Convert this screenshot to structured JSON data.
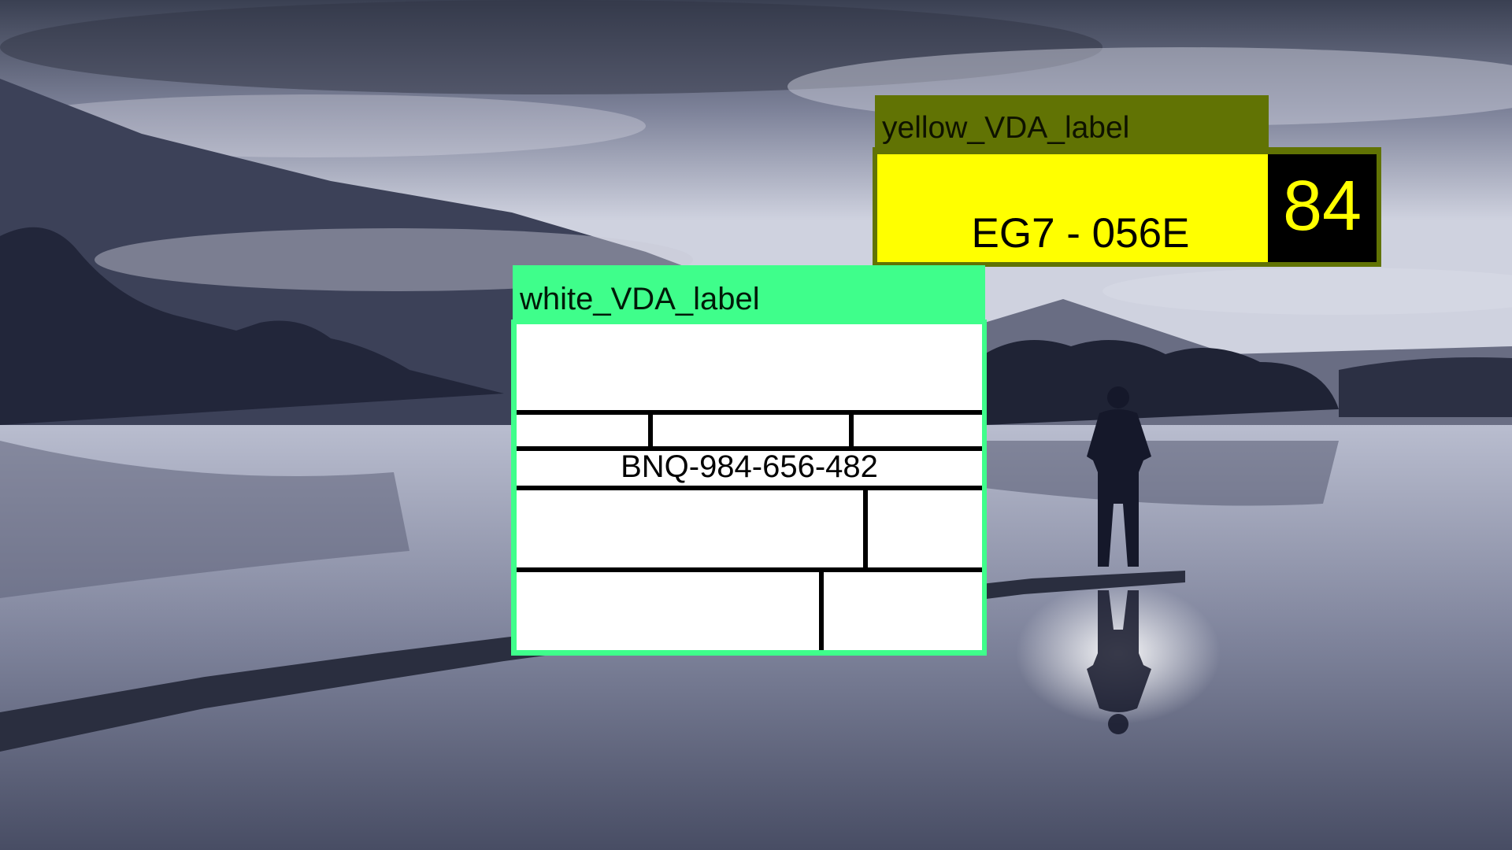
{
  "yellow_label": {
    "title": "yellow_VDA_label",
    "code": "EG7 - 056E",
    "number": "84",
    "colors": {
      "header": "#617304",
      "body": "#ffff00",
      "number_box": "#000000",
      "number_text": "#ffff00"
    }
  },
  "white_label": {
    "title": "white_VDA_label",
    "code": "BNQ-984-656-482",
    "colors": {
      "header": "#3ffe8b",
      "body": "#ffffff",
      "grid_lines": "#000000"
    }
  }
}
